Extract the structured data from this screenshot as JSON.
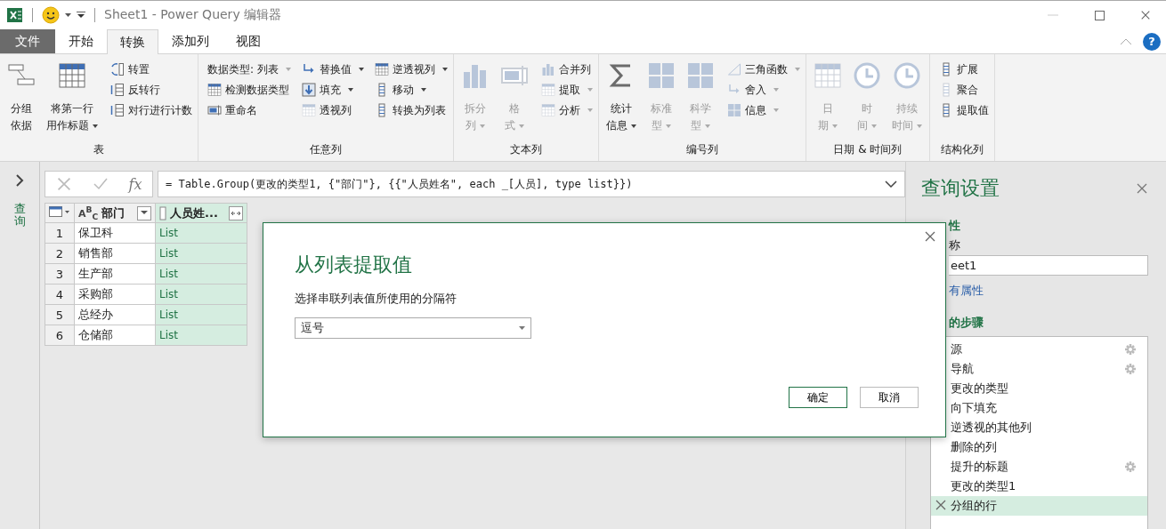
{
  "window": {
    "title": "Sheet1 - Power Query 编辑器"
  },
  "tabs": [
    {
      "label": "文件",
      "kind": "file",
      "selected": false
    },
    {
      "label": "开始",
      "kind": "tab",
      "selected": false
    },
    {
      "label": "转换",
      "kind": "tab",
      "selected": true
    },
    {
      "label": "添加列",
      "kind": "tab",
      "selected": false
    },
    {
      "label": "视图",
      "kind": "tab",
      "selected": false
    }
  ],
  "help": "?",
  "ribbon": [
    {
      "label": "表",
      "columns": [
        {
          "kind": "large",
          "lines": [
            "分组",
            "依据"
          ],
          "dropdown": false,
          "disabled": false
        },
        {
          "kind": "large",
          "lines": [
            "将第一行",
            "用作标题"
          ],
          "dropdown": true,
          "disabled": false
        },
        {
          "kind": "stack",
          "items": [
            {
              "label": "转置",
              "dropdown": false,
              "disabled": false
            },
            {
              "label": "反转行",
              "dropdown": false,
              "disabled": false
            },
            {
              "label": "对行进行计数",
              "dropdown": false,
              "disabled": false
            }
          ]
        }
      ]
    },
    {
      "label": "任意列",
      "columns": [
        {
          "kind": "stack",
          "items": [
            {
              "label": "数据类型: 列表",
              "dropdown": true,
              "disabled": true,
              "kind": "noicon"
            },
            {
              "label": "检测数据类型",
              "dropdown": false,
              "disabled": false
            },
            {
              "label": "重命名",
              "dropdown": false,
              "disabled": false
            }
          ]
        },
        {
          "kind": "stack",
          "items": [
            {
              "label": "替换值",
              "dropdown": true,
              "disabled": false
            },
            {
              "label": "填充",
              "dropdown": true,
              "disabled": false
            },
            {
              "label": "透视列",
              "dropdown": false,
              "disabled": true
            }
          ]
        },
        {
          "kind": "stack",
          "items": [
            {
              "label": "逆透视列",
              "dropdown": true,
              "disabled": false
            },
            {
              "label": "移动",
              "dropdown": true,
              "disabled": false
            },
            {
              "label": "转换为列表",
              "dropdown": false,
              "disabled": false
            }
          ]
        }
      ]
    },
    {
      "label": "文本列",
      "columns": [
        {
          "kind": "large",
          "lines": [
            "拆分",
            "列"
          ],
          "dropdown": true,
          "disabled": true
        },
        {
          "kind": "large",
          "lines": [
            "格",
            "式"
          ],
          "dropdown": true,
          "disabled": true
        },
        {
          "kind": "stack",
          "items": [
            {
              "label": "合并列",
              "dropdown": false,
              "disabled": true
            },
            {
              "label": "提取",
              "dropdown": true,
              "disabled": true
            },
            {
              "label": "分析",
              "dropdown": true,
              "disabled": true
            }
          ]
        }
      ]
    },
    {
      "label": "编号列",
      "columns": [
        {
          "kind": "large",
          "lines": [
            "统计",
            "信息"
          ],
          "dropdown": true,
          "disabled": false
        },
        {
          "kind": "large",
          "lines": [
            "标准",
            "型"
          ],
          "dropdown": true,
          "disabled": true
        },
        {
          "kind": "large",
          "lines": [
            "科学",
            "型"
          ],
          "dropdown": true,
          "disabled": true
        },
        {
          "kind": "stack",
          "items": [
            {
              "label": "三角函数",
              "dropdown": true,
              "disabled": true
            },
            {
              "label": "舍入",
              "dropdown": true,
              "disabled": true
            },
            {
              "label": "信息",
              "dropdown": true,
              "disabled": true
            }
          ]
        }
      ]
    },
    {
      "label": "日期 & 时间列",
      "columns": [
        {
          "kind": "large",
          "lines": [
            "日",
            "期"
          ],
          "dropdown": true,
          "disabled": true
        },
        {
          "kind": "large",
          "lines": [
            "时",
            "间"
          ],
          "dropdown": true,
          "disabled": true
        },
        {
          "kind": "large",
          "lines": [
            "持续",
            "时间"
          ],
          "dropdown": true,
          "disabled": true
        }
      ]
    },
    {
      "label": "结构化列",
      "columns": [
        {
          "kind": "stack",
          "items": [
            {
              "label": "扩展",
              "dropdown": false,
              "disabled": false
            },
            {
              "label": "聚合",
              "dropdown": false,
              "disabled": true
            },
            {
              "label": "提取值",
              "dropdown": false,
              "disabled": false
            }
          ]
        }
      ]
    }
  ],
  "queries_pane": {
    "label": "查询"
  },
  "formula_bar": {
    "function_label": "fx",
    "formula": "= Table.Group(更改的类型1, {\"部门\"}, {{\"人员姓名\", each _[人员], type list}})"
  },
  "table": {
    "columns": [
      {
        "label": "部门",
        "type_label": "A$^{B}$$_{C}$",
        "kind": "text"
      },
      {
        "label": "人员姓...",
        "kind": "list"
      }
    ],
    "rows": [
      {
        "number": "1",
        "cells": [
          "保卫科",
          "List"
        ]
      },
      {
        "number": "2",
        "cells": [
          "销售部",
          "List"
        ]
      },
      {
        "number": "3",
        "cells": [
          "生产部",
          "List"
        ]
      },
      {
        "number": "4",
        "cells": [
          "采购部",
          "List"
        ]
      },
      {
        "number": "5",
        "cells": [
          "总经办",
          "List"
        ]
      },
      {
        "number": "6",
        "cells": [
          "仓储部",
          "List"
        ]
      }
    ]
  },
  "query_settings": {
    "title": "查询设置",
    "properties_heading": "性",
    "name_label": "称",
    "name_value": "eet1",
    "all_properties_link": "有属性",
    "steps_heading": "的步骤",
    "steps": [
      {
        "label": "源",
        "gear": true,
        "selected": false
      },
      {
        "label": "导航",
        "gear": true,
        "selected": false
      },
      {
        "label": "更改的类型",
        "gear": false,
        "selected": false
      },
      {
        "label": "向下填充",
        "gear": false,
        "selected": false
      },
      {
        "label": "逆透视的其他列",
        "gear": false,
        "selected": false
      },
      {
        "label": "删除的列",
        "gear": false,
        "selected": false
      },
      {
        "label": "提升的标题",
        "gear": true,
        "selected": false
      },
      {
        "label": "更改的类型1",
        "gear": false,
        "selected": false
      },
      {
        "label": "分组的行",
        "gear": false,
        "selected": true
      }
    ]
  },
  "dialog": {
    "title": "从列表提取值",
    "label": "选择串联列表值所使用的分隔符",
    "value": "逗号",
    "buttons": [
      {
        "label": "确定",
        "default": true
      },
      {
        "label": "取消",
        "default": false
      }
    ]
  }
}
